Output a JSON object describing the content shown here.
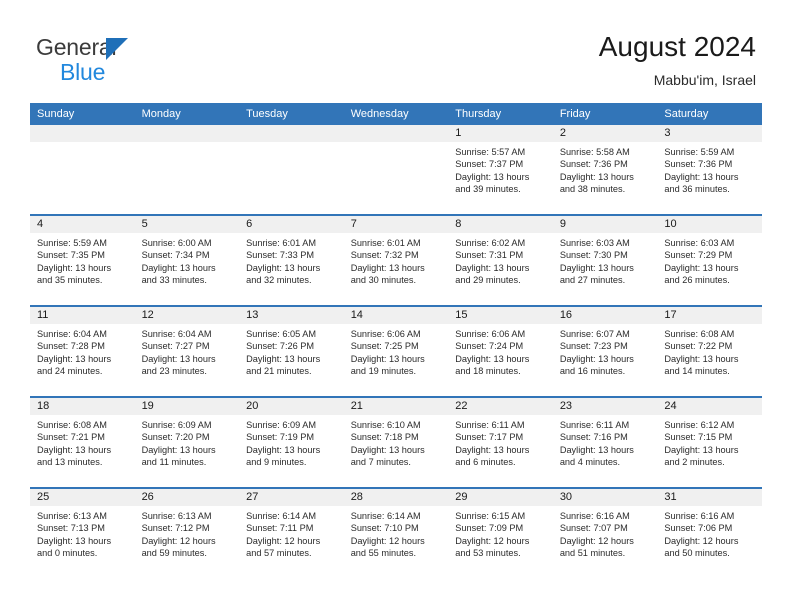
{
  "brand": {
    "name_top": "General",
    "name_bottom": "Blue",
    "triangle_color": "#1f6fb8",
    "blue_color": "#2288dd",
    "general_color": "#3b3b3b"
  },
  "header": {
    "title": "August 2024",
    "subtitle": "Mabbu'im, Israel"
  },
  "colors": {
    "header_blue": "#3275b8",
    "daynum_band": "#f0f0f0",
    "text": "#2b2b2b"
  },
  "weekday_headers": [
    "Sunday",
    "Monday",
    "Tuesday",
    "Wednesday",
    "Thursday",
    "Friday",
    "Saturday"
  ],
  "weeks": [
    [
      {
        "day": "",
        "sunrise": "",
        "sunset": "",
        "daylight_1": "",
        "daylight_2": ""
      },
      {
        "day": "",
        "sunrise": "",
        "sunset": "",
        "daylight_1": "",
        "daylight_2": ""
      },
      {
        "day": "",
        "sunrise": "",
        "sunset": "",
        "daylight_1": "",
        "daylight_2": ""
      },
      {
        "day": "",
        "sunrise": "",
        "sunset": "",
        "daylight_1": "",
        "daylight_2": ""
      },
      {
        "day": "1",
        "sunrise": "Sunrise: 5:57 AM",
        "sunset": "Sunset: 7:37 PM",
        "daylight_1": "Daylight: 13 hours",
        "daylight_2": "and 39 minutes."
      },
      {
        "day": "2",
        "sunrise": "Sunrise: 5:58 AM",
        "sunset": "Sunset: 7:36 PM",
        "daylight_1": "Daylight: 13 hours",
        "daylight_2": "and 38 minutes."
      },
      {
        "day": "3",
        "sunrise": "Sunrise: 5:59 AM",
        "sunset": "Sunset: 7:36 PM",
        "daylight_1": "Daylight: 13 hours",
        "daylight_2": "and 36 minutes."
      }
    ],
    [
      {
        "day": "4",
        "sunrise": "Sunrise: 5:59 AM",
        "sunset": "Sunset: 7:35 PM",
        "daylight_1": "Daylight: 13 hours",
        "daylight_2": "and 35 minutes."
      },
      {
        "day": "5",
        "sunrise": "Sunrise: 6:00 AM",
        "sunset": "Sunset: 7:34 PM",
        "daylight_1": "Daylight: 13 hours",
        "daylight_2": "and 33 minutes."
      },
      {
        "day": "6",
        "sunrise": "Sunrise: 6:01 AM",
        "sunset": "Sunset: 7:33 PM",
        "daylight_1": "Daylight: 13 hours",
        "daylight_2": "and 32 minutes."
      },
      {
        "day": "7",
        "sunrise": "Sunrise: 6:01 AM",
        "sunset": "Sunset: 7:32 PM",
        "daylight_1": "Daylight: 13 hours",
        "daylight_2": "and 30 minutes."
      },
      {
        "day": "8",
        "sunrise": "Sunrise: 6:02 AM",
        "sunset": "Sunset: 7:31 PM",
        "daylight_1": "Daylight: 13 hours",
        "daylight_2": "and 29 minutes."
      },
      {
        "day": "9",
        "sunrise": "Sunrise: 6:03 AM",
        "sunset": "Sunset: 7:30 PM",
        "daylight_1": "Daylight: 13 hours",
        "daylight_2": "and 27 minutes."
      },
      {
        "day": "10",
        "sunrise": "Sunrise: 6:03 AM",
        "sunset": "Sunset: 7:29 PM",
        "daylight_1": "Daylight: 13 hours",
        "daylight_2": "and 26 minutes."
      }
    ],
    [
      {
        "day": "11",
        "sunrise": "Sunrise: 6:04 AM",
        "sunset": "Sunset: 7:28 PM",
        "daylight_1": "Daylight: 13 hours",
        "daylight_2": "and 24 minutes."
      },
      {
        "day": "12",
        "sunrise": "Sunrise: 6:04 AM",
        "sunset": "Sunset: 7:27 PM",
        "daylight_1": "Daylight: 13 hours",
        "daylight_2": "and 23 minutes."
      },
      {
        "day": "13",
        "sunrise": "Sunrise: 6:05 AM",
        "sunset": "Sunset: 7:26 PM",
        "daylight_1": "Daylight: 13 hours",
        "daylight_2": "and 21 minutes."
      },
      {
        "day": "14",
        "sunrise": "Sunrise: 6:06 AM",
        "sunset": "Sunset: 7:25 PM",
        "daylight_1": "Daylight: 13 hours",
        "daylight_2": "and 19 minutes."
      },
      {
        "day": "15",
        "sunrise": "Sunrise: 6:06 AM",
        "sunset": "Sunset: 7:24 PM",
        "daylight_1": "Daylight: 13 hours",
        "daylight_2": "and 18 minutes."
      },
      {
        "day": "16",
        "sunrise": "Sunrise: 6:07 AM",
        "sunset": "Sunset: 7:23 PM",
        "daylight_1": "Daylight: 13 hours",
        "daylight_2": "and 16 minutes."
      },
      {
        "day": "17",
        "sunrise": "Sunrise: 6:08 AM",
        "sunset": "Sunset: 7:22 PM",
        "daylight_1": "Daylight: 13 hours",
        "daylight_2": "and 14 minutes."
      }
    ],
    [
      {
        "day": "18",
        "sunrise": "Sunrise: 6:08 AM",
        "sunset": "Sunset: 7:21 PM",
        "daylight_1": "Daylight: 13 hours",
        "daylight_2": "and 13 minutes."
      },
      {
        "day": "19",
        "sunrise": "Sunrise: 6:09 AM",
        "sunset": "Sunset: 7:20 PM",
        "daylight_1": "Daylight: 13 hours",
        "daylight_2": "and 11 minutes."
      },
      {
        "day": "20",
        "sunrise": "Sunrise: 6:09 AM",
        "sunset": "Sunset: 7:19 PM",
        "daylight_1": "Daylight: 13 hours",
        "daylight_2": "and 9 minutes."
      },
      {
        "day": "21",
        "sunrise": "Sunrise: 6:10 AM",
        "sunset": "Sunset: 7:18 PM",
        "daylight_1": "Daylight: 13 hours",
        "daylight_2": "and 7 minutes."
      },
      {
        "day": "22",
        "sunrise": "Sunrise: 6:11 AM",
        "sunset": "Sunset: 7:17 PM",
        "daylight_1": "Daylight: 13 hours",
        "daylight_2": "and 6 minutes."
      },
      {
        "day": "23",
        "sunrise": "Sunrise: 6:11 AM",
        "sunset": "Sunset: 7:16 PM",
        "daylight_1": "Daylight: 13 hours",
        "daylight_2": "and 4 minutes."
      },
      {
        "day": "24",
        "sunrise": "Sunrise: 6:12 AM",
        "sunset": "Sunset: 7:15 PM",
        "daylight_1": "Daylight: 13 hours",
        "daylight_2": "and 2 minutes."
      }
    ],
    [
      {
        "day": "25",
        "sunrise": "Sunrise: 6:13 AM",
        "sunset": "Sunset: 7:13 PM",
        "daylight_1": "Daylight: 13 hours",
        "daylight_2": "and 0 minutes."
      },
      {
        "day": "26",
        "sunrise": "Sunrise: 6:13 AM",
        "sunset": "Sunset: 7:12 PM",
        "daylight_1": "Daylight: 12 hours",
        "daylight_2": "and 59 minutes."
      },
      {
        "day": "27",
        "sunrise": "Sunrise: 6:14 AM",
        "sunset": "Sunset: 7:11 PM",
        "daylight_1": "Daylight: 12 hours",
        "daylight_2": "and 57 minutes."
      },
      {
        "day": "28",
        "sunrise": "Sunrise: 6:14 AM",
        "sunset": "Sunset: 7:10 PM",
        "daylight_1": "Daylight: 12 hours",
        "daylight_2": "and 55 minutes."
      },
      {
        "day": "29",
        "sunrise": "Sunrise: 6:15 AM",
        "sunset": "Sunset: 7:09 PM",
        "daylight_1": "Daylight: 12 hours",
        "daylight_2": "and 53 minutes."
      },
      {
        "day": "30",
        "sunrise": "Sunrise: 6:16 AM",
        "sunset": "Sunset: 7:07 PM",
        "daylight_1": "Daylight: 12 hours",
        "daylight_2": "and 51 minutes."
      },
      {
        "day": "31",
        "sunrise": "Sunrise: 6:16 AM",
        "sunset": "Sunset: 7:06 PM",
        "daylight_1": "Daylight: 12 hours",
        "daylight_2": "and 50 minutes."
      }
    ]
  ]
}
